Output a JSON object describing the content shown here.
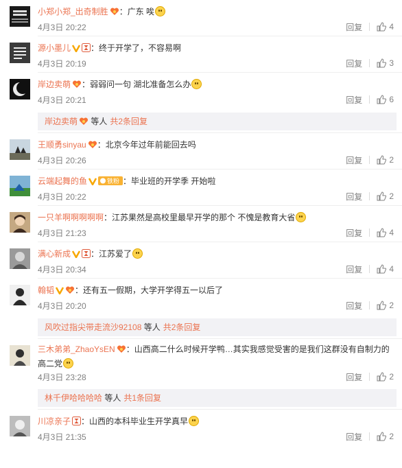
{
  "comments": [
    {
      "user": "小郑小郑_出奇制胜",
      "text": "：广东 唉",
      "time": "4月3日 20:22",
      "reply": "回复",
      "likes": "4"
    },
    {
      "user": "源小墨儿",
      "text": "：终于开学了，不容易啊",
      "time": "4月3日 20:19",
      "reply": "回复",
      "likes": "3"
    },
    {
      "user": "岸边卖萌",
      "text": "：弱弱问一句 湖北准备怎么办",
      "time": "4月3日 20:21",
      "reply": "回复",
      "likes": "6"
    },
    {
      "user": "王顺勇sinyau",
      "text": "：北京今年过年前能回去吗",
      "time": "4月3日 20:26",
      "reply": "回复",
      "likes": "2"
    },
    {
      "user": "云端起舞的鱼",
      "text": "：毕业班的开学季 开始啦",
      "time": "4月3日 20:22",
      "reply": "回复",
      "likes": "2",
      "fan_badge": "铁粉"
    },
    {
      "user": "一只羊啊啊啊啊啊",
      "text": "：江苏果然是高校里最早开学的那个 不愧是教育大省",
      "time": "4月3日 21:23",
      "reply": "回复",
      "likes": "4"
    },
    {
      "user": "满心新成",
      "text": "：江苏爱了",
      "time": "4月3日 20:34",
      "reply": "回复",
      "likes": "4"
    },
    {
      "user": "翰韬",
      "text": "：还有五一假期，大学开学得五一以后了",
      "time": "4月3日 20:20",
      "reply": "回复",
      "likes": "2"
    },
    {
      "user": "三木弟弟_ZhaoYsEN",
      "text": "：山西高二什么时候开学鸭…其实我感觉受害的是我们这群没有自制力的高二党",
      "time": "4月3日 23:28",
      "reply": "回复",
      "likes": "2"
    },
    {
      "user": "川凉亲子",
      "text": "：山西的本科毕业生开学真早",
      "time": "4月3日 21:35",
      "reply": "回复",
      "likes": "2"
    }
  ],
  "more": [
    {
      "user": "岸边卖萌",
      "suffix": "等人",
      "count": "共2条回复"
    },
    {
      "user": "风吹过指尖带走流沙92108",
      "suffix": "等人",
      "count": "共2条回复"
    },
    {
      "user": "林千伊哈哈哈哈",
      "suffix": "等人",
      "count": "共1条回复"
    }
  ],
  "colors": {
    "username": "#eb7350",
    "meta": "#808080",
    "reply_box": "#f2f2f5"
  }
}
